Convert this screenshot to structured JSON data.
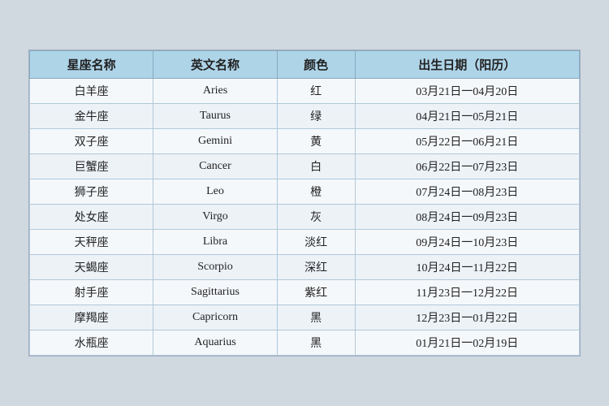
{
  "table": {
    "headers": [
      "星座名称",
      "英文名称",
      "颜色",
      "出生日期（阳历）"
    ],
    "rows": [
      {
        "chinese": "白羊座",
        "english": "Aries",
        "color": "红",
        "dates": "03月21日一04月20日"
      },
      {
        "chinese": "金牛座",
        "english": "Taurus",
        "color": "绿",
        "dates": "04月21日一05月21日"
      },
      {
        "chinese": "双子座",
        "english": "Gemini",
        "color": "黄",
        "dates": "05月22日一06月21日"
      },
      {
        "chinese": "巨蟹座",
        "english": "Cancer",
        "color": "白",
        "dates": "06月22日一07月23日"
      },
      {
        "chinese": "狮子座",
        "english": "Leo",
        "color": "橙",
        "dates": "07月24日一08月23日"
      },
      {
        "chinese": "处女座",
        "english": "Virgo",
        "color": "灰",
        "dates": "08月24日一09月23日"
      },
      {
        "chinese": "天秤座",
        "english": "Libra",
        "color": "淡红",
        "dates": "09月24日一10月23日"
      },
      {
        "chinese": "天蝎座",
        "english": "Scorpio",
        "color": "深红",
        "dates": "10月24日一11月22日"
      },
      {
        "chinese": "射手座",
        "english": "Sagittarius",
        "color": "紫红",
        "dates": "11月23日一12月22日"
      },
      {
        "chinese": "摩羯座",
        "english": "Capricorn",
        "color": "黑",
        "dates": "12月23日一01月22日"
      },
      {
        "chinese": "水瓶座",
        "english": "Aquarius",
        "color": "黑",
        "dates": "01月21日一02月19日"
      }
    ]
  }
}
